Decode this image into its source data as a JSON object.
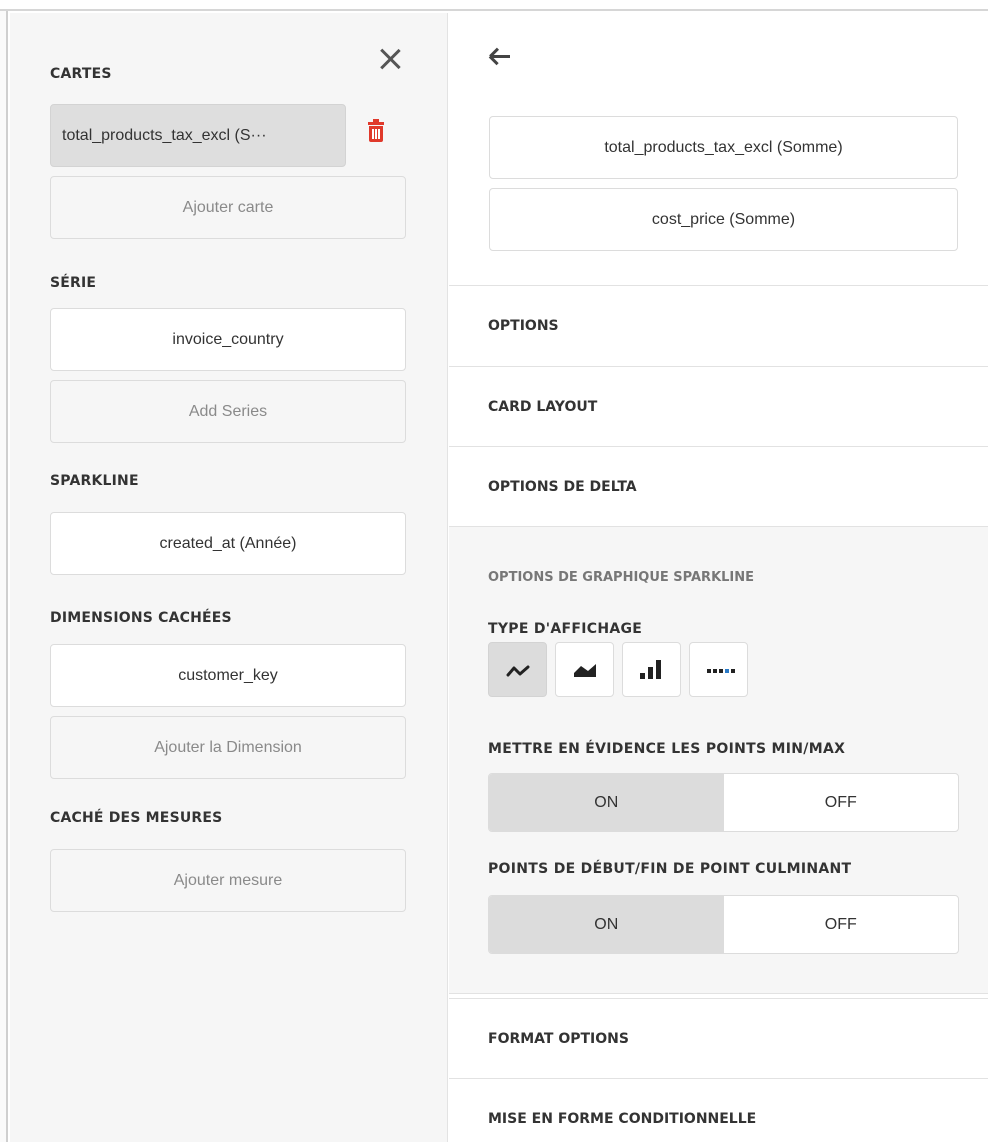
{
  "left_panel": {
    "cartes": {
      "title": "CARTES",
      "selected_item": "total_products_tax_excl (S···",
      "add_label": "Ajouter carte"
    },
    "serie": {
      "title": "SÉRIE",
      "item": "invoice_country",
      "add_label": "Add Series"
    },
    "sparkline": {
      "title": "SPARKLINE",
      "item": "created_at (Année)"
    },
    "hidden_dimensions": {
      "title": "DIMENSIONS CACHÉES",
      "item": "customer_key",
      "add_label": "Ajouter la Dimension"
    },
    "hidden_measures": {
      "title": "CACHÉ DES MESURES",
      "add_label": "Ajouter mesure"
    }
  },
  "right_panel": {
    "measures": [
      "total_products_tax_excl (Somme)",
      "cost_price (Somme)"
    ],
    "sections": {
      "options": "OPTIONS",
      "card_layout": "CARD LAYOUT",
      "delta_options": "OPTIONS DE DELTA",
      "format_options": "FORMAT OPTIONS",
      "conditional_formatting": "MISE EN FORME CONDITIONNELLE"
    },
    "sparkline_options": {
      "title": "OPTIONS DE GRAPHIQUE SPARKLINE",
      "display_type_label": "TYPE D'AFFICHAGE",
      "display_types": [
        "line",
        "area",
        "bar",
        "win-loss"
      ],
      "active_display_type": "line",
      "highlight_minmax": {
        "label": "METTRE EN ÉVIDENCE LES POINTS MIN/MAX",
        "on": "ON",
        "off": "OFF",
        "value": "ON"
      },
      "highlight_startend": {
        "label": "POINTS DE DÉBUT/FIN DE POINT CULMINANT",
        "on": "ON",
        "off": "OFF",
        "value": "ON"
      }
    }
  },
  "colors": {
    "delete_icon": "#e0392b",
    "panel_bg": "#f6f6f6",
    "active_toggle": "#dcdcdc",
    "winloss_blue": "#2a7ac7"
  },
  "icons": [
    "close-icon",
    "trash-icon",
    "back-arrow-icon",
    "line-chart-icon",
    "area-chart-icon",
    "bar-chart-icon",
    "win-loss-icon"
  ]
}
